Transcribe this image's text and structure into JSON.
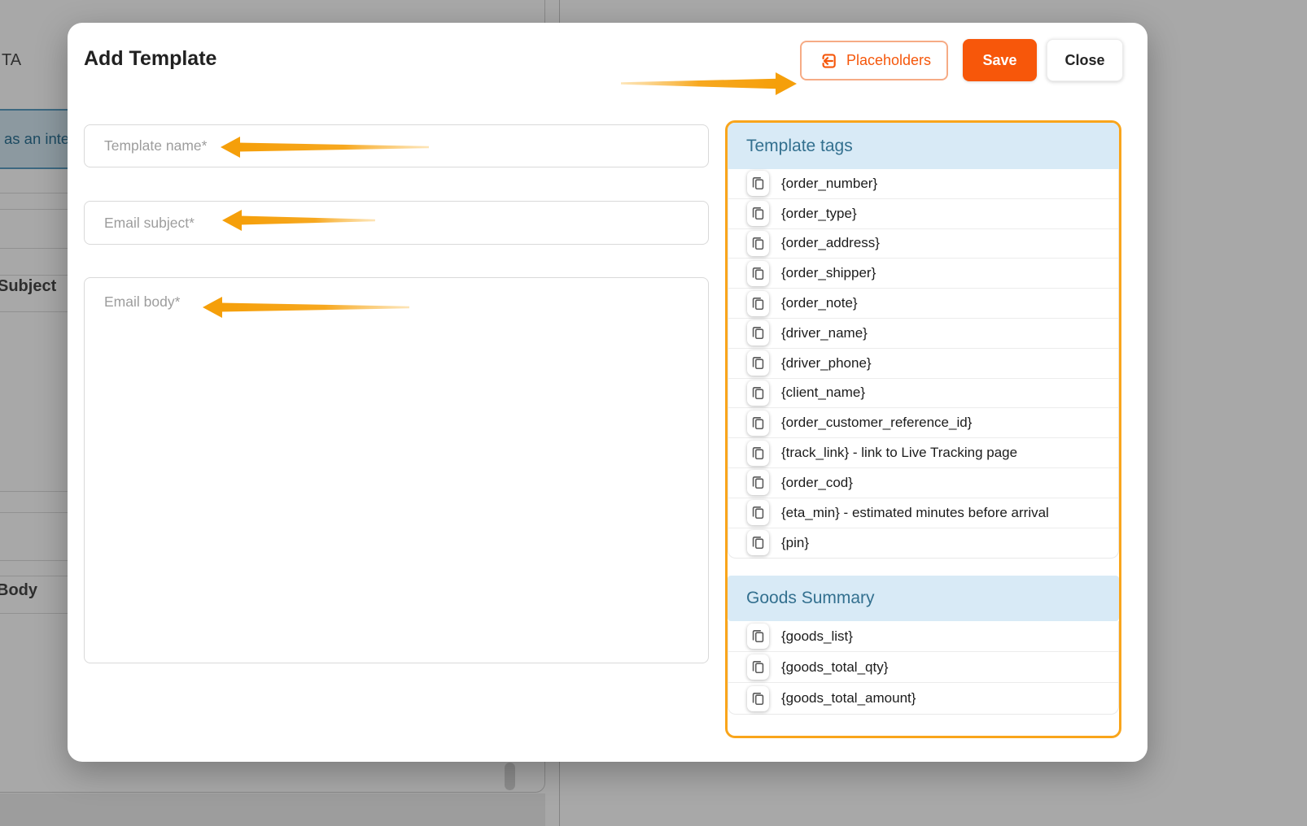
{
  "background": {
    "tab_label": "TA",
    "integration_row_label": "as an inte",
    "subject_label": "Subject",
    "body_label": "Body"
  },
  "modal": {
    "title": "Add Template",
    "placeholders_button": "Placeholders",
    "save_button": "Save",
    "close_button": "Close",
    "template_name_placeholder": "Template name*",
    "email_subject_placeholder": "Email subject*",
    "email_body_placeholder": "Email body*"
  },
  "tags_panel": {
    "sections": [
      {
        "title": "Template tags",
        "items": [
          "{order_number}",
          "{order_type}",
          "{order_address}",
          "{order_shipper}",
          "{order_note}",
          "{driver_name}",
          "{driver_phone}",
          "{client_name}",
          "{order_customer_reference_id}",
          "{track_link} - link to Live Tracking page",
          "{order_cod}",
          "{eta_min} - estimated minutes before arrival",
          "{pin}"
        ]
      },
      {
        "title": "Goods Summary",
        "items": [
          "{goods_list}",
          "{goods_total_qty}",
          "{goods_total_amount}"
        ]
      }
    ]
  },
  "icons": {
    "copy": "content-copy-icon",
    "placeholders": "insert-placeholder-icon",
    "annotations": "orange-pointer-arrow"
  },
  "colors": {
    "accent_orange": "#F7570A",
    "panel_border_orange": "#F9A51B",
    "section_header_bg": "#D8EAF6",
    "section_header_text": "#33708F",
    "arrow_amber": "#F5A01C",
    "background_row_teal": "#2C7295"
  }
}
